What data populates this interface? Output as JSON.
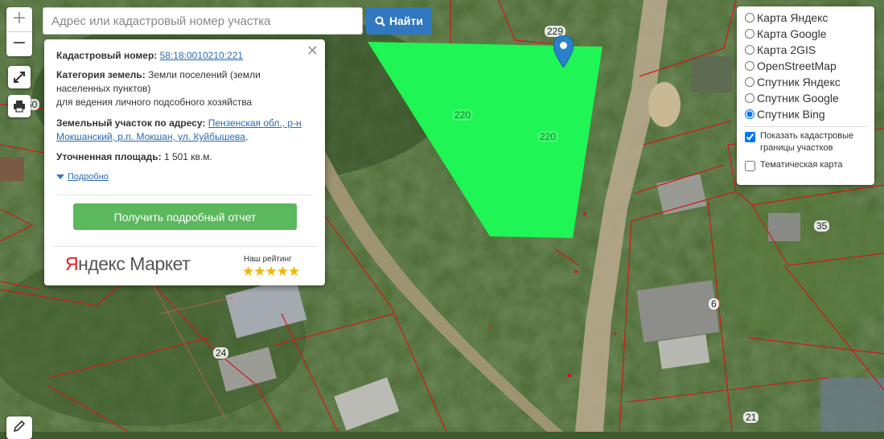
{
  "search": {
    "placeholder": "Адрес или кадастровый номер участка",
    "button_label": "Найти"
  },
  "zoom": {
    "in": "+",
    "out": "−"
  },
  "popup": {
    "cadastral_label": "Кадастровый номер:",
    "cadastral_value": "58:18:0010210:221",
    "category_label": "Категория земель:",
    "category_value": "Земли поселений (земли населенных пунктов)",
    "usage": "для ведения личного подсобного хозяйства",
    "address_label": "Земельный участок по адресу:",
    "address_value": "Пензенская обл., р-н Мокшанский, р.п. Мокшан, ул. Куйбышева,",
    "area_label": "Уточненная площадь:",
    "area_value": "1 501 кв.м.",
    "details_link": "Подробно",
    "report_button": "Получить подробный отчет",
    "close": "✕",
    "market_logo_y": "Я",
    "market_logo_rest": "ндекс Маркет",
    "rating_label": "Наш рейтинг",
    "rating_stars": 5,
    "stars_text": "★★★★★"
  },
  "layers": {
    "options": [
      {
        "label": "Карта Яндекс",
        "checked": false
      },
      {
        "label": "Карта Google",
        "checked": false
      },
      {
        "label": "Карта 2GIS",
        "checked": false
      },
      {
        "label": "OpenStreetMap",
        "checked": false
      },
      {
        "label": "Спутник Яндекс",
        "checked": false
      },
      {
        "label": "Спутник Google",
        "checked": false
      },
      {
        "label": "Спутник Bing",
        "checked": true
      }
    ],
    "show_borders_label": "Показать кадастровые границы участков",
    "show_borders_checked": true,
    "thematic_label": "Тематическая карта",
    "thematic_checked": false
  },
  "map_labels": {
    "parcel_229": "229",
    "parcel_35": "35",
    "parcel_6": "6",
    "parcel_24": "24",
    "parcel_21": "21",
    "parcel_50": "50",
    "parcel_220a": "220",
    "parcel_220b": "220"
  },
  "colors": {
    "selected_parcel": "#1ff554",
    "boundary": "#d01818",
    "marker": "#2a81cb",
    "report_button": "#5cb85c",
    "search_button": "#3278c0"
  }
}
